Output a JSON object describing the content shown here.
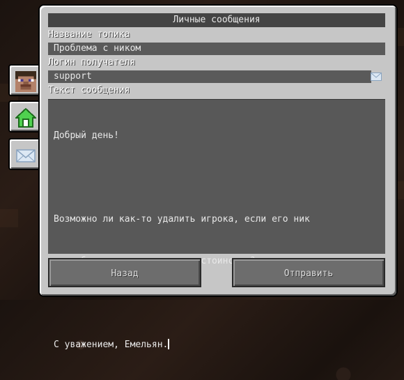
{
  "window": {
    "title": "Личные сообщения"
  },
  "form": {
    "topic_label": "Название топика",
    "topic_value": "Проблема с ником",
    "recipient_label": "Логин получателя",
    "recipient_value": "support",
    "message_label": "Текст сообщения",
    "message_lines": [
      "Добрый день!",
      "",
      "Возможно ли как-то удалить игрока, если его ник",
      "оскорбляет мои чувства и достоинство?",
      "",
      "С уважением, Емельян."
    ]
  },
  "buttons": {
    "back_label": "Назад",
    "send_label": "Отправить"
  },
  "tabs": [
    {
      "icon": "player-head-icon",
      "active": false
    },
    {
      "icon": "home-icon",
      "active": false
    },
    {
      "icon": "envelope-icon",
      "active": true
    }
  ],
  "colors": {
    "panel": "#c6c6c6",
    "field": "#5a5a5a",
    "title_bar": "#444444",
    "button": "#6d6d6d",
    "home_green": "#4fd14f"
  }
}
